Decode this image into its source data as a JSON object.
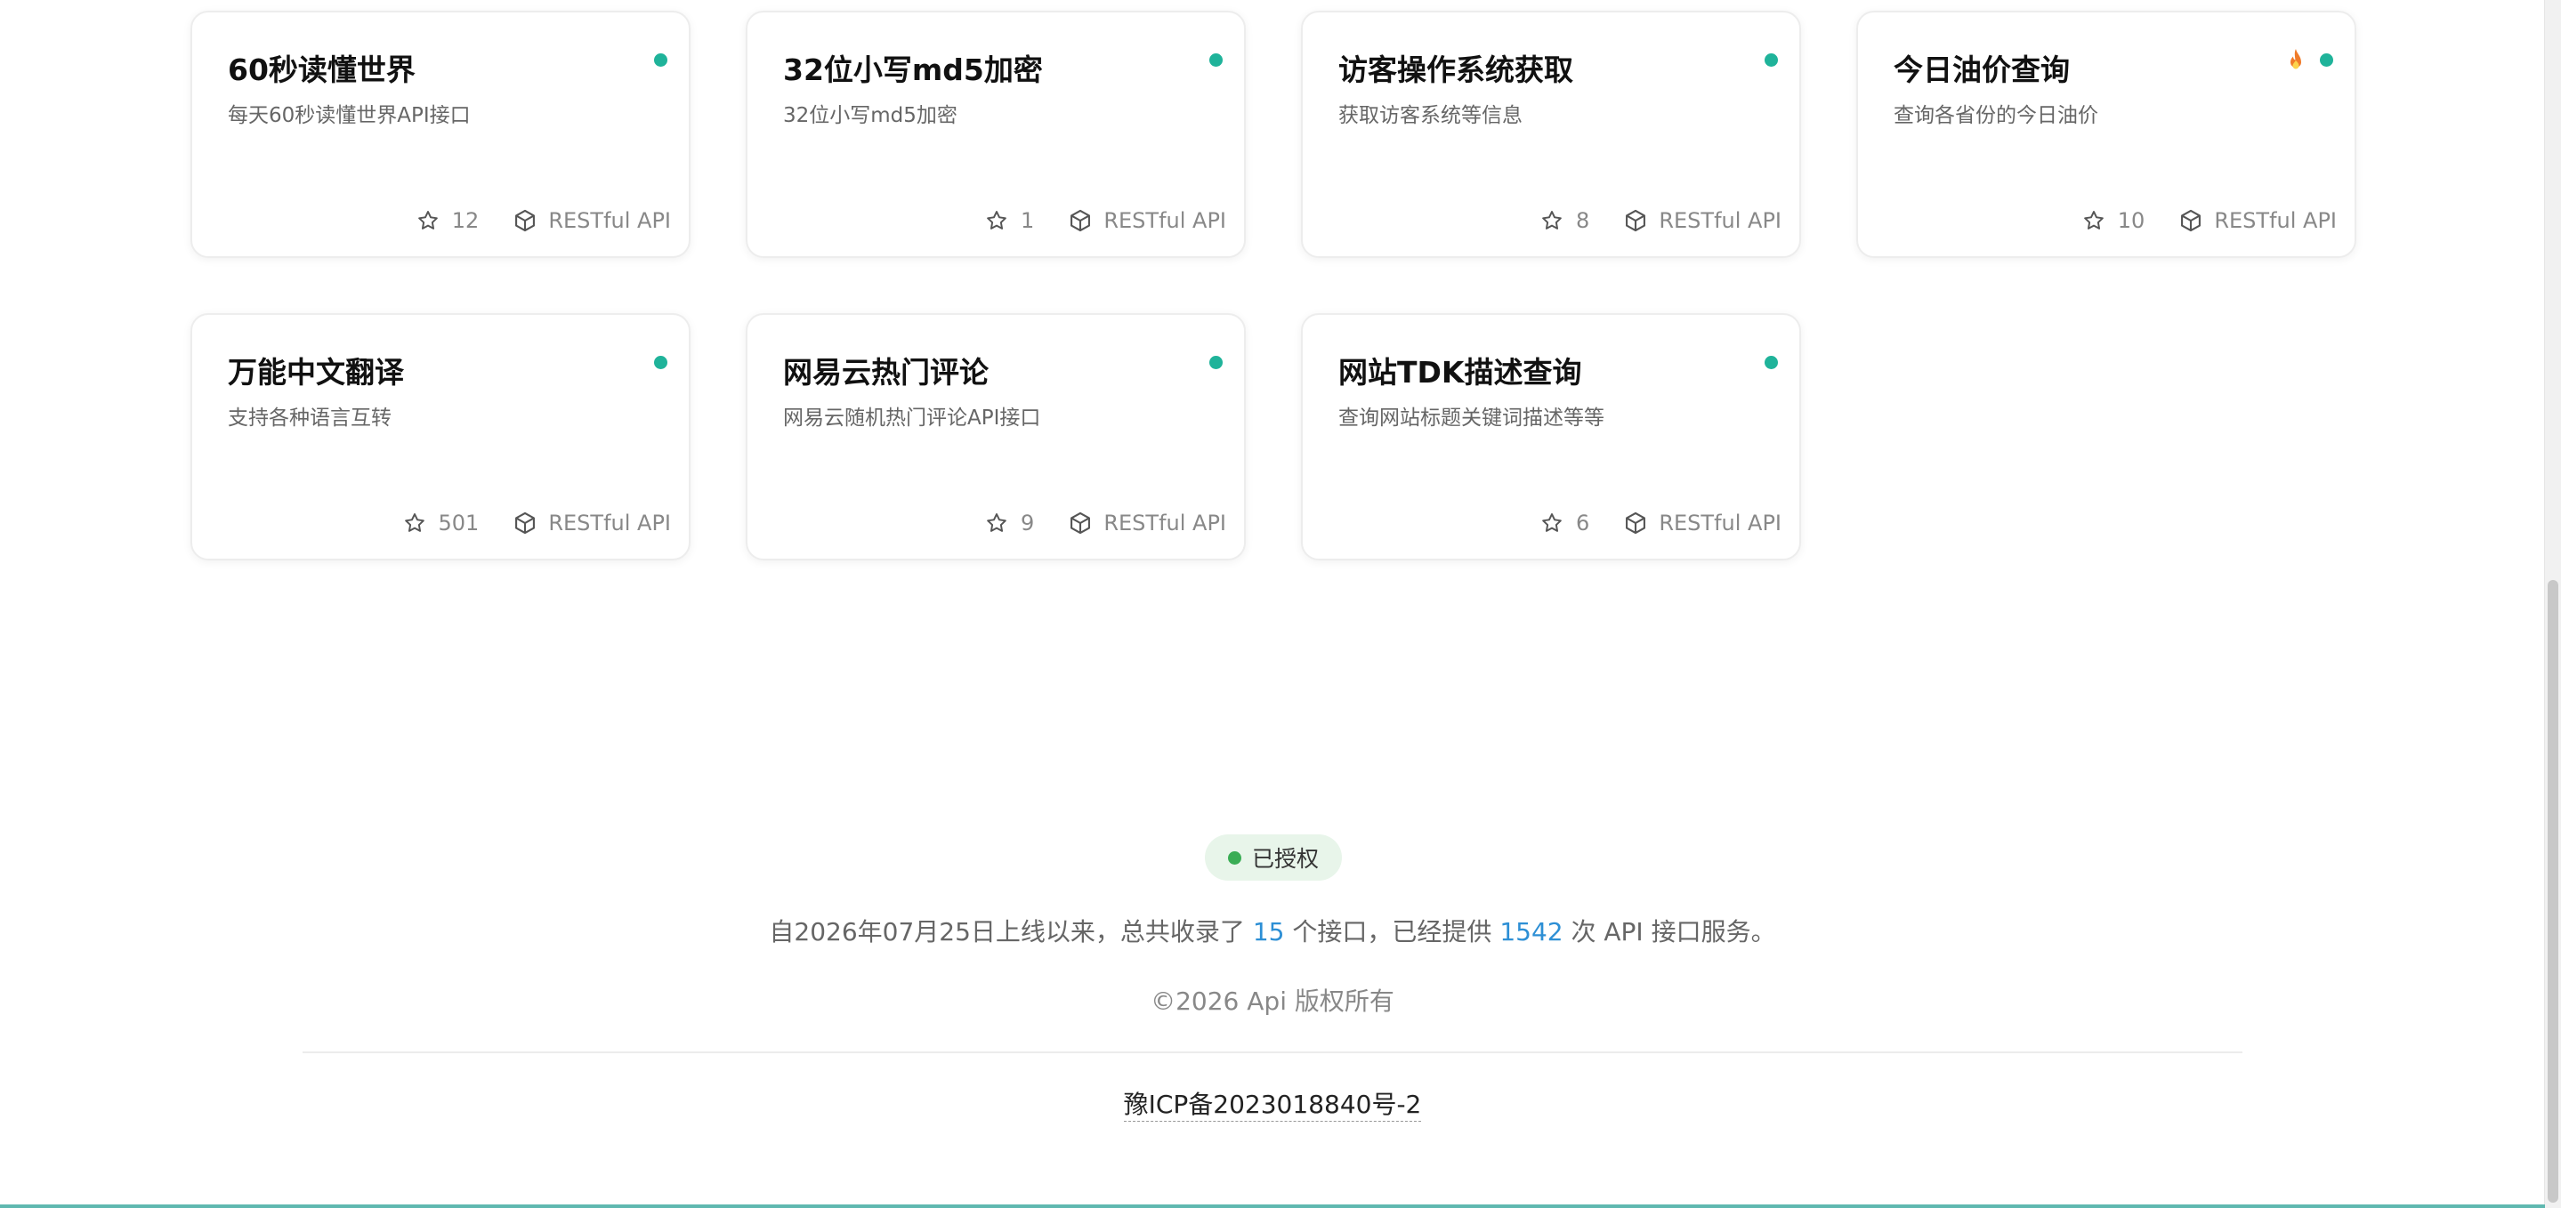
{
  "cards": [
    {
      "title": "60秒读懂世界",
      "desc": "每天60秒读懂世界API接口",
      "stars": "12",
      "type": "RESTful API",
      "hot": false
    },
    {
      "title": "32位小写md5加密",
      "desc": "32位小写md5加密",
      "stars": "1",
      "type": "RESTful API",
      "hot": false
    },
    {
      "title": "访客操作系统获取",
      "desc": "获取访客系统等信息",
      "stars": "8",
      "type": "RESTful API",
      "hot": false
    },
    {
      "title": "今日油价查询",
      "desc": "查询各省份的今日油价",
      "stars": "10",
      "type": "RESTful API",
      "hot": true
    },
    {
      "title": "万能中文翻译",
      "desc": "支持各种语言互转",
      "stars": "501",
      "type": "RESTful API",
      "hot": false
    },
    {
      "title": "网易云热门评论",
      "desc": "网易云随机热门评论API接口",
      "stars": "9",
      "type": "RESTful API",
      "hot": false
    },
    {
      "title": "网站TDK描述查询",
      "desc": "查询网站标题关键词描述等等",
      "stars": "6",
      "type": "RESTful API",
      "hot": false
    }
  ],
  "footer": {
    "badge": "已授权",
    "stats_prefix": "自2026年07月25日上线以来，总共收录了",
    "api_count": "15",
    "stats_middle": "个接口，已经提供",
    "service_count": "1542",
    "stats_suffix": "次 API 接口服务。",
    "copyright": "©2026 Api 版权所有",
    "icp": "豫ICP备2023018840号-2"
  },
  "colors": {
    "status_online": "#1fb39a",
    "link_number": "#2d8fd5",
    "badge_bg": "#e8f5ea",
    "badge_dot": "#3aad55"
  },
  "icons": {
    "star": "star-icon",
    "api_type": "cube-icon",
    "hot": "fire-icon",
    "status": "status-dot"
  }
}
